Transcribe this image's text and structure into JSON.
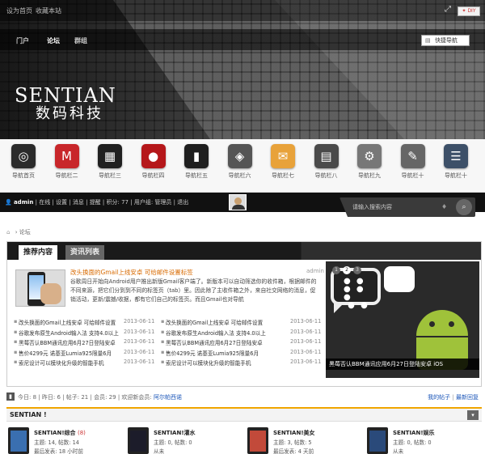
{
  "topbar": {
    "set_home": "设为首页",
    "bookmark": "收藏本站",
    "diy": "DIY",
    "expand_icon": "expand-icon"
  },
  "nav": {
    "items": [
      "门户",
      "论坛",
      "群组"
    ],
    "active": "论坛",
    "quick_nav": "快捷导航"
  },
  "logo": {
    "text": "SENTIAN",
    "cn": "数码科技"
  },
  "icon_nav": [
    {
      "label": "导航首页",
      "color": "#2b2b2b",
      "glyph": "◎"
    },
    {
      "label": "导航栏二",
      "color": "#c8262a",
      "glyph": "M"
    },
    {
      "label": "导航栏三",
      "color": "#202020",
      "glyph": "▦"
    },
    {
      "label": "导航栏四",
      "color": "#b5171a",
      "glyph": "●"
    },
    {
      "label": "导航栏五",
      "color": "#1e1e1e",
      "glyph": "▮"
    },
    {
      "label": "导航栏六",
      "color": "#555555",
      "glyph": "◈"
    },
    {
      "label": "导航栏七",
      "color": "#e8a23a",
      "glyph": "✉"
    },
    {
      "label": "导航栏八",
      "color": "#4a4a4a",
      "glyph": "▤"
    },
    {
      "label": "导航栏九",
      "color": "#777777",
      "glyph": "⚙"
    },
    {
      "label": "导航栏十",
      "color": "#666666",
      "glyph": "✎"
    },
    {
      "label": "导航栏十",
      "color": "#3d5068",
      "glyph": "☰"
    }
  ],
  "userbar": {
    "username": "admin",
    "items": [
      "在线",
      "设置",
      "消息",
      "提醒"
    ],
    "points": "积分: 77",
    "group": "用户组: 管理员",
    "logout": "退出"
  },
  "search": {
    "placeholder": "请输入搜索内容"
  },
  "breadcrumb": {
    "current": "论坛"
  },
  "portal": {
    "tabs": [
      "推荐内容",
      "资讯列表"
    ],
    "feature": {
      "title": "改头换面的Gmail上线安卓 可给邮件设置标签",
      "author": "admin",
      "desc": "谷歌周日开始向Android用户推出新版Gmail客户端了。新版本可以自动筛选你的收件箱，根据邮件的不同来源，把它们分到到不同的标签页（tab）里。因此除了主收件箱之外，来自社交网络的消息，促销活动，更新/震撼/收据，都有它们自己的标签页。而且Gmail也对导航"
    },
    "list": [
      {
        "t1": "改头换面的Gmail上线安卓 可给邮件设置",
        "d1": "2013-06-11",
        "t2": "改头换面的Gmail上线安卓 可给邮件设置",
        "d2": "2013-06-11"
      },
      {
        "t1": "谷歌发布原生Android输入法 支持4.0以上",
        "d1": "2013-06-11",
        "t2": "谷歌发布原生Android输入法 支持4.0以上",
        "d2": "2013-06-11"
      },
      {
        "t1": "黑莓否认BBM通讯应用6月27日登陆安卓",
        "d1": "2013-06-11",
        "t2": "黑莓否认BBM通讯应用6月27日登陆安卓",
        "d2": "2013-06-11"
      },
      {
        "t1": "售价4299元 诺基亚Lumia925限量6月",
        "d1": "2013-06-11",
        "t2": "售价4299元 诺基亚Lumia925限量6月",
        "d2": "2013-06-11"
      },
      {
        "t1": "索尼设计可以模块化升级的智能手机",
        "d1": "2013-06-11",
        "t2": "索尼设计可以模块化升级的智能手机",
        "d2": "2013-06-11"
      }
    ],
    "slide": {
      "caption": "黑莓否认BBM通讯应用6月27日登陆安卓 iOS",
      "pages": [
        "1",
        "2",
        "3"
      ],
      "active_page": 2
    }
  },
  "stats": {
    "today_label": "今日:",
    "today": "8",
    "yesterday_label": "昨日:",
    "yesterday": "6",
    "posts_label": "帖子:",
    "posts": "21",
    "members_label": "会员:",
    "members": "29",
    "newest_label": "欢迎新会员:",
    "newest": "阿尔帕西诺",
    "my_posts": "我的帖子",
    "latest_replies": "最新回复"
  },
  "category": {
    "title": "SENTIAN !"
  },
  "forums": [
    {
      "name": "SENTIAN!综合",
      "new": "(8)",
      "stats": "主题: 14, 帖数: 14",
      "last": "最后发表: 18 小时前",
      "screen": "#3a6fb0"
    },
    {
      "name": "SENTIAN!灌水",
      "new": "",
      "stats": "主题: 0, 帖数: 0",
      "last": "从未",
      "screen": "#1c1c2a"
    },
    {
      "name": "SENTIAN!美女",
      "new": "",
      "stats": "主题: 3, 帖数: 5",
      "last": "最后发表: 4 天前",
      "screen": "#c24a3a"
    },
    {
      "name": "SENTIAN!娱乐",
      "new": "",
      "stats": "主题: 0, 帖数: 0",
      "last": "从未",
      "screen": "#2a4a7a"
    }
  ]
}
